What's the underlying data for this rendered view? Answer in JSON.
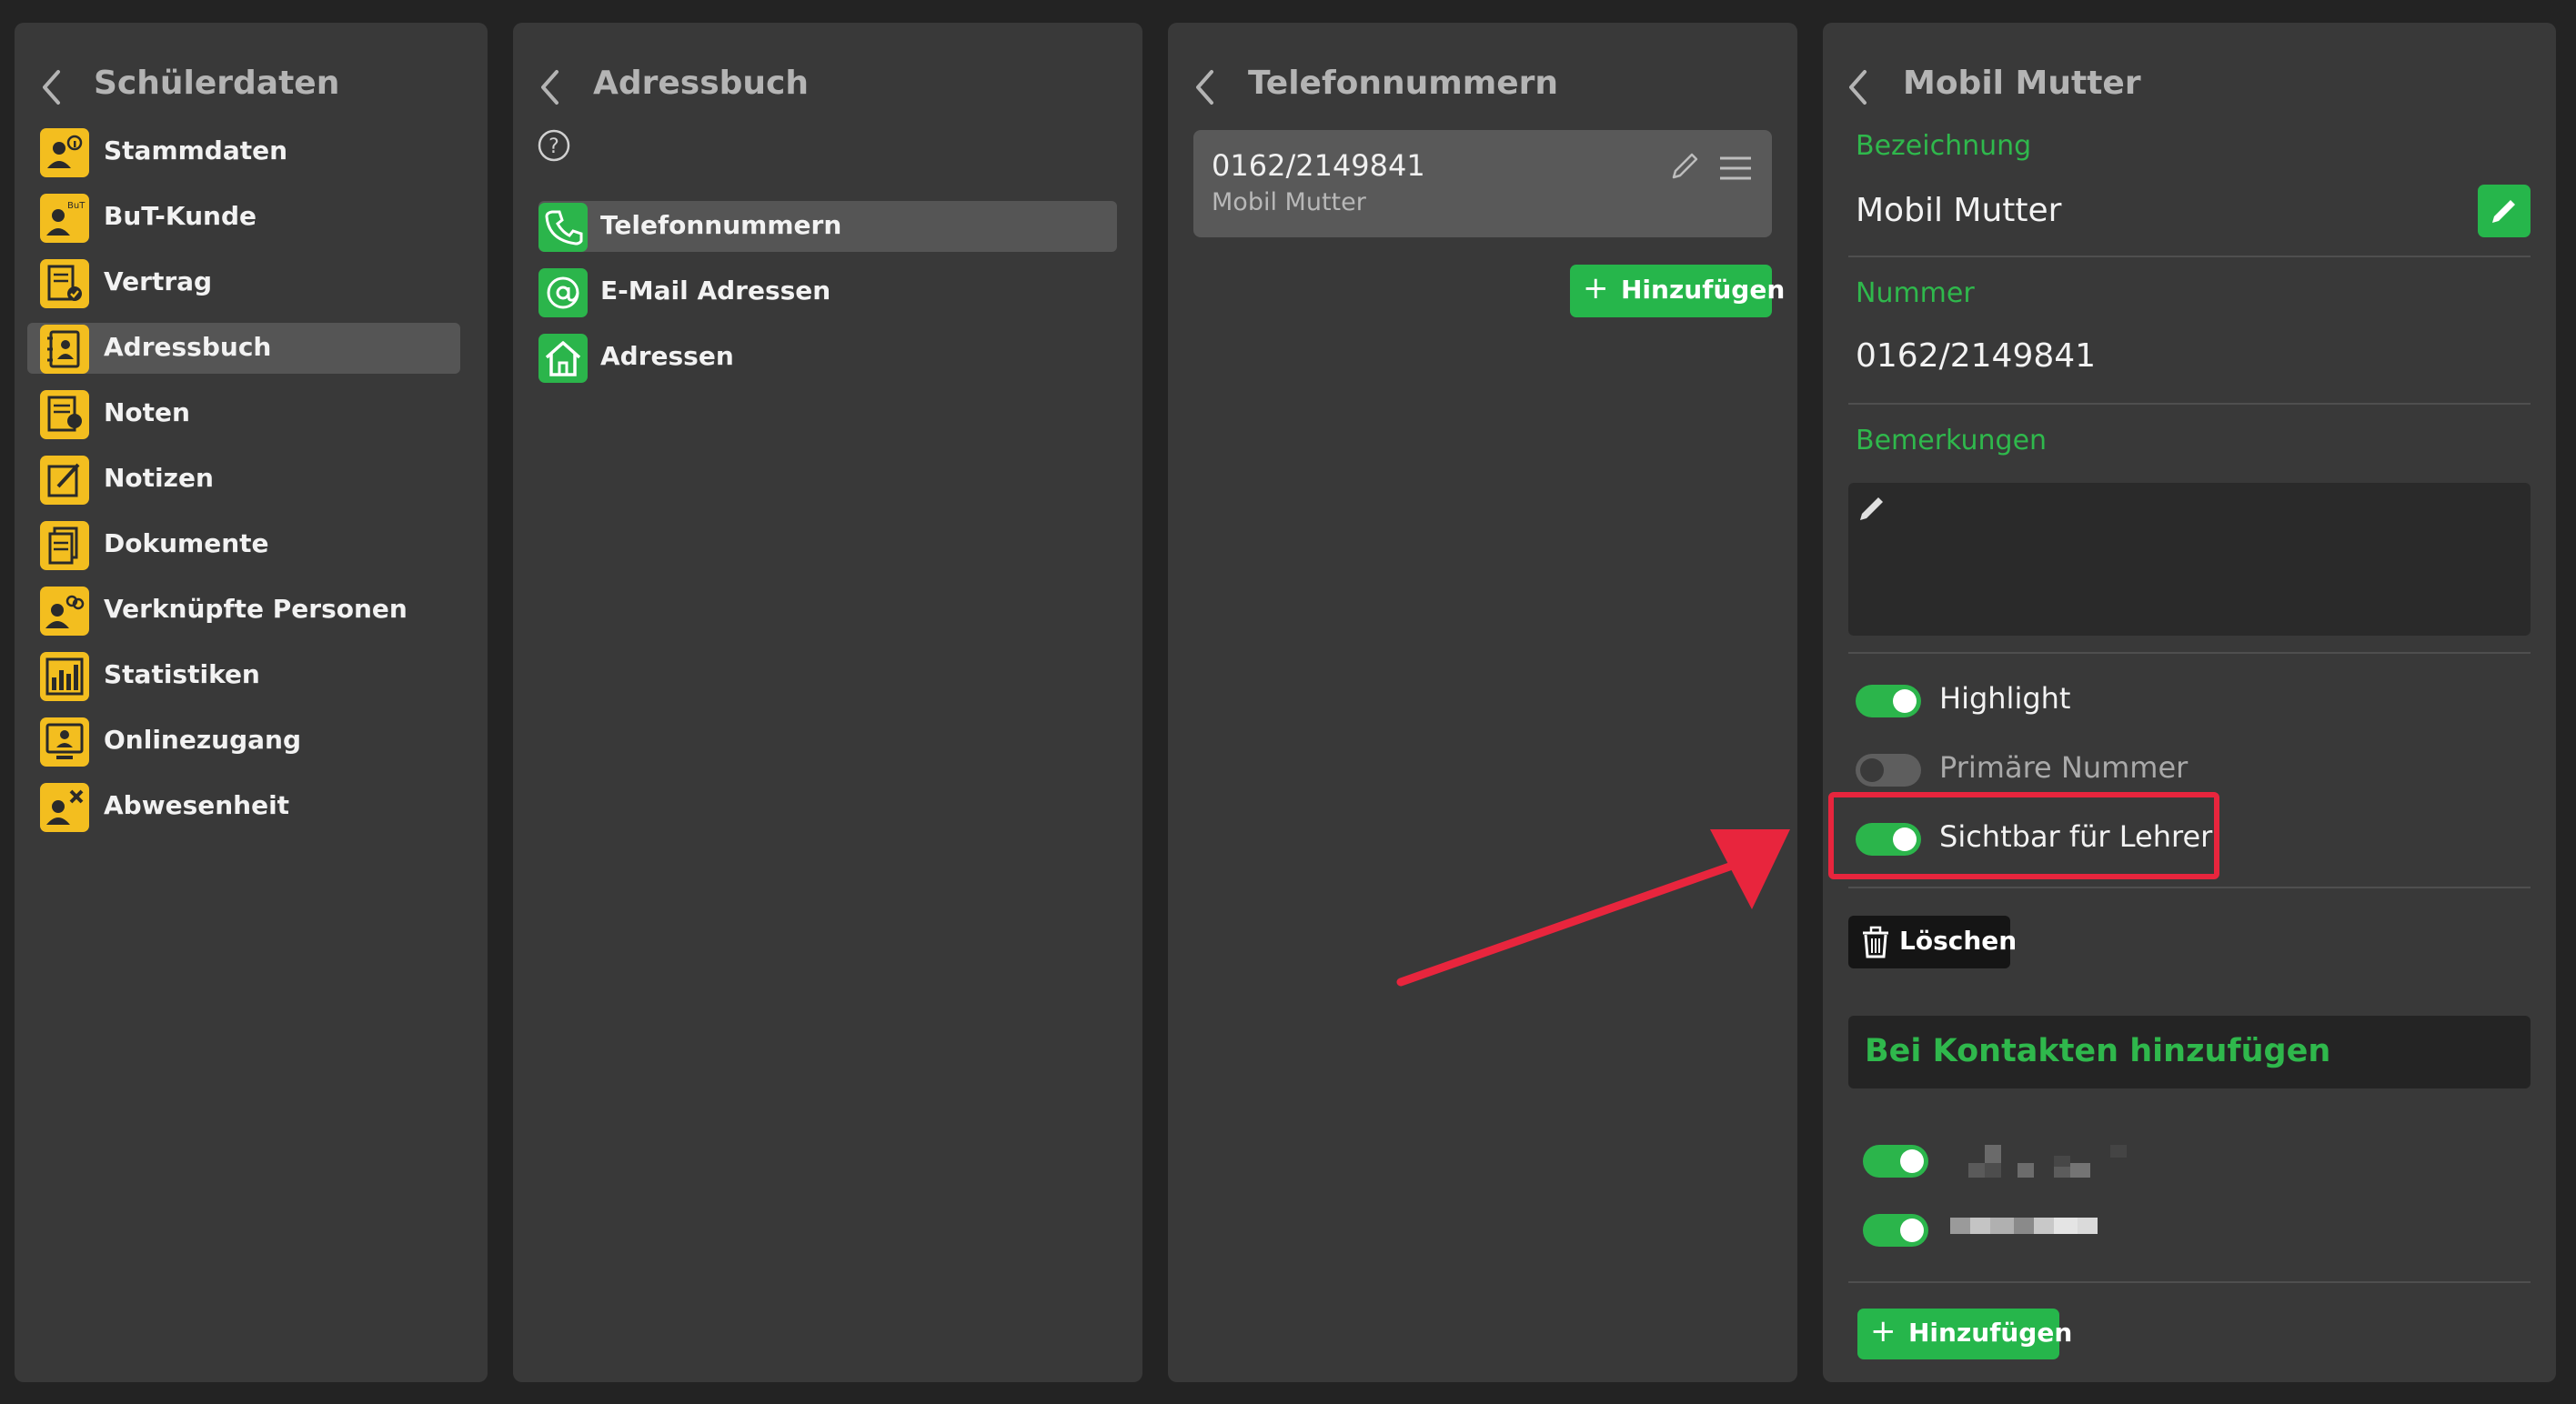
{
  "colors": {
    "background": "#232323",
    "panel": "#393939",
    "selected_row": "#555555",
    "accent_green": "#2bb54b",
    "nav_icon_yellow": "#f3be1f",
    "highlight_red": "#e8253d"
  },
  "student_panel": {
    "title": "Schülerdaten",
    "items": [
      {
        "label": "Stammdaten",
        "icon": "person-info-icon"
      },
      {
        "label": "BuT-Kunde",
        "icon": "but-customer-icon"
      },
      {
        "label": "Vertrag",
        "icon": "contract-icon"
      },
      {
        "label": "Adressbuch",
        "icon": "address-book-icon",
        "selected": true
      },
      {
        "label": "Noten",
        "icon": "grades-icon"
      },
      {
        "label": "Notizen",
        "icon": "notes-icon"
      },
      {
        "label": "Dokumente",
        "icon": "documents-icon"
      },
      {
        "label": "Verknüpfte Personen",
        "icon": "linked-persons-icon"
      },
      {
        "label": "Statistiken",
        "icon": "statistics-icon"
      },
      {
        "label": "Onlinezugang",
        "icon": "online-access-icon"
      },
      {
        "label": "Abwesenheit",
        "icon": "absence-icon"
      }
    ]
  },
  "addressbook_panel": {
    "title": "Adressbuch",
    "items": [
      {
        "label": "Telefonnummern",
        "icon": "phone-icon",
        "selected": true
      },
      {
        "label": "E-Mail Adressen",
        "icon": "at-icon"
      },
      {
        "label": "Adressen",
        "icon": "house-icon"
      }
    ]
  },
  "phones_panel": {
    "title": "Telefonnummern",
    "entries": [
      {
        "number": "0162/2149841",
        "label": "Mobil Mutter"
      }
    ],
    "add_label": "Hinzufügen"
  },
  "detail_panel": {
    "title": "Mobil Mutter",
    "fields": {
      "designation_label": "Bezeichnung",
      "designation_value": "Mobil Mutter",
      "number_label": "Nummer",
      "number_value": "0162/2149841",
      "remarks_label": "Bemerkungen"
    },
    "toggles": [
      {
        "label": "Highlight",
        "on": true
      },
      {
        "label": "Primäre Nummer",
        "on": false
      },
      {
        "label": "Sichtbar für Lehrer",
        "on": true
      }
    ],
    "delete_label": "Löschen",
    "contacts_header": "Bei Kontakten hinzufügen",
    "contacts": [
      {
        "on": true
      },
      {
        "on": true
      }
    ],
    "add_label": "Hinzufügen"
  }
}
